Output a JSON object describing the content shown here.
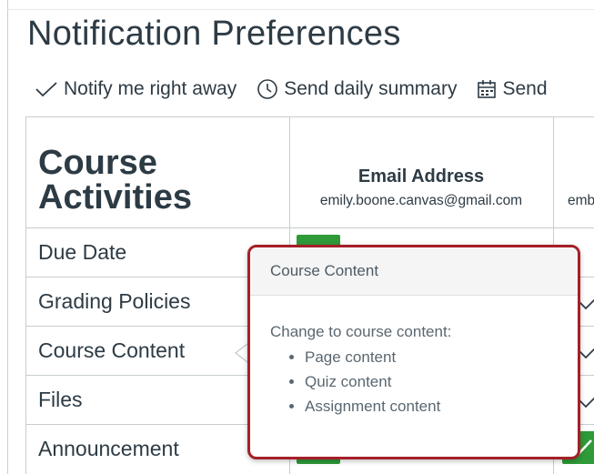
{
  "page": {
    "title": "Notification Preferences"
  },
  "legend": {
    "items": [
      {
        "icon": "check-icon",
        "label": "Notify me right away"
      },
      {
        "icon": "clock-icon",
        "label": "Send daily summary"
      },
      {
        "icon": "calendar-icon",
        "label": "Send"
      }
    ]
  },
  "table": {
    "section_title_line1": "Course",
    "section_title_line2": "Activities",
    "columns": [
      {
        "name": "Email Address",
        "address": "emily.boone.canvas@gmail.com"
      },
      {
        "name": "E",
        "address": "emb"
      }
    ],
    "rows": [
      {
        "label": "Due Date"
      },
      {
        "label": "Grading Policies"
      },
      {
        "label": "Course Content"
      },
      {
        "label": "Files"
      },
      {
        "label": "Announcement"
      }
    ]
  },
  "popover": {
    "header": "Course Content",
    "intro": "Change to course content:",
    "items": [
      "Page content",
      "Quiz content",
      "Assignment content"
    ]
  },
  "colors": {
    "accent_green": "#2e9a38",
    "popover_border": "#a61f28",
    "text": "#2d3b45"
  }
}
